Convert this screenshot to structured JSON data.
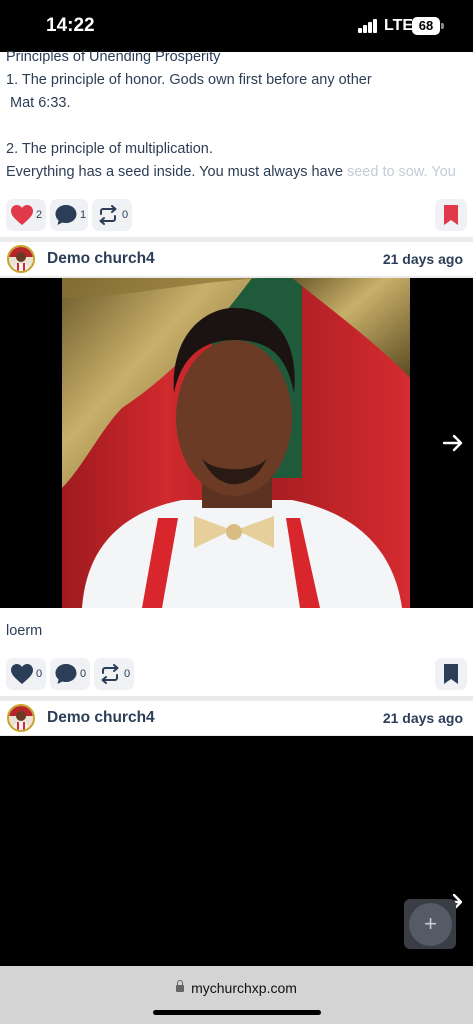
{
  "status_bar": {
    "time": "14:22",
    "network": "LTE",
    "battery": "68"
  },
  "post1": {
    "lines": [
      "Principles of Unending Prosperity",
      "1. The principle of honor. Gods own first before any other",
      " Mat 6:33.",
      "",
      "2. The principle of multiplication."
    ],
    "last_line": "Everything has a seed inside. You must always have ",
    "last_line_faded": "seed to sow. You",
    "likes": "2",
    "comments": "1",
    "shares": "0"
  },
  "post2": {
    "author": "Demo church4",
    "time": "21 days ago",
    "caption": "loerm",
    "likes": "0",
    "comments": "0",
    "shares": "0"
  },
  "post3": {
    "author": "Demo church4",
    "time": "21 days ago"
  },
  "fab_label": "+",
  "browser": {
    "url": "mychurchxp.com"
  },
  "colors": {
    "accent_red": "#e2394a",
    "text_navy": "#2c3e57"
  }
}
